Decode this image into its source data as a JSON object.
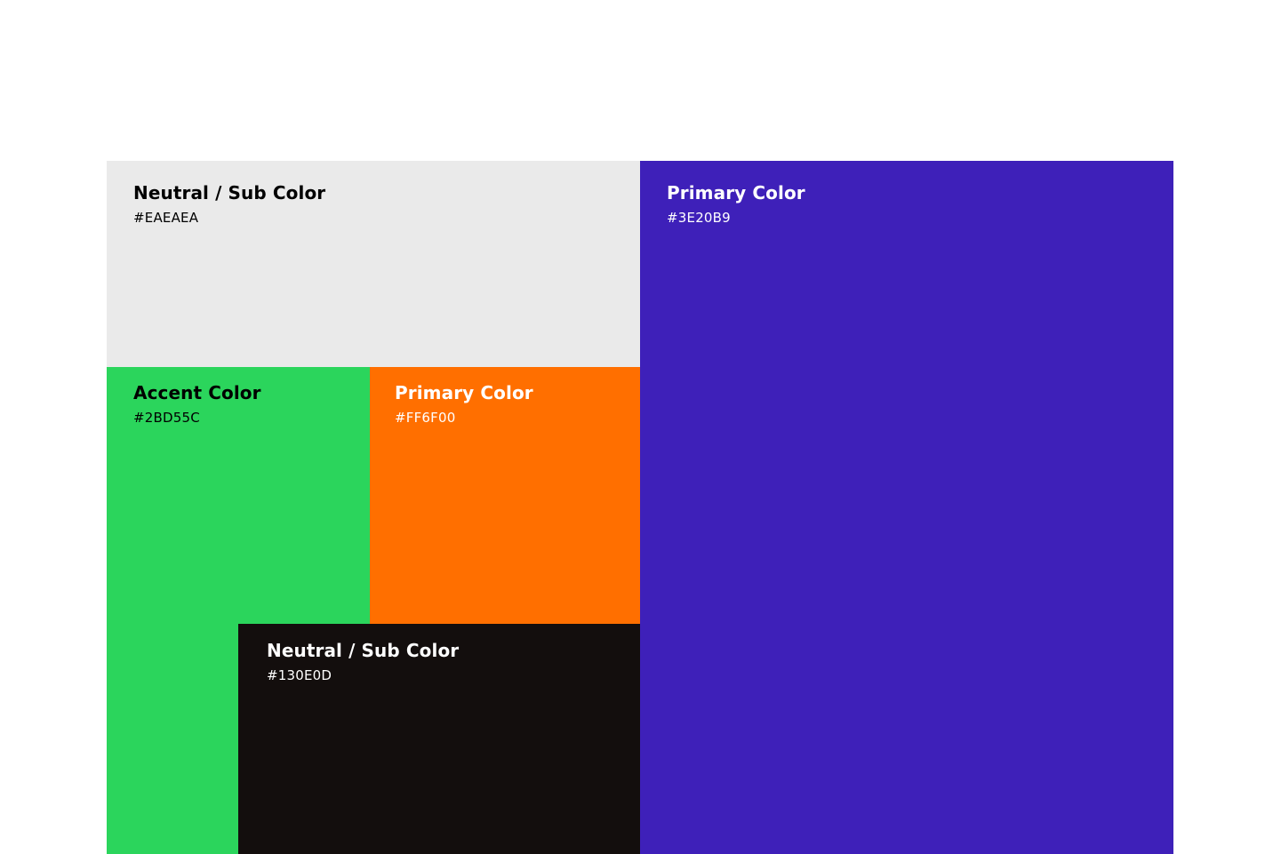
{
  "swatches": {
    "light": {
      "name": "Neutral / Sub Color",
      "hex": "#EAEAEA",
      "color": "#EAEAEA",
      "text_color": "#000000"
    },
    "purple": {
      "name": "Primary Color",
      "hex": "#3E20B9",
      "color": "#3E20B9",
      "text_color": "#FFFFFF"
    },
    "green": {
      "name": "Accent Color",
      "hex": "#2BD55C",
      "color": "#2BD55C",
      "text_color": "#000000"
    },
    "orange": {
      "name": "Primary Color",
      "hex": "#FF6F00",
      "color": "#FF6F00",
      "text_color": "#FFFFFF"
    },
    "dark": {
      "name": "Neutral / Sub Color",
      "hex": "#130E0D",
      "color": "#130E0D",
      "text_color": "#FFFFFF"
    }
  }
}
